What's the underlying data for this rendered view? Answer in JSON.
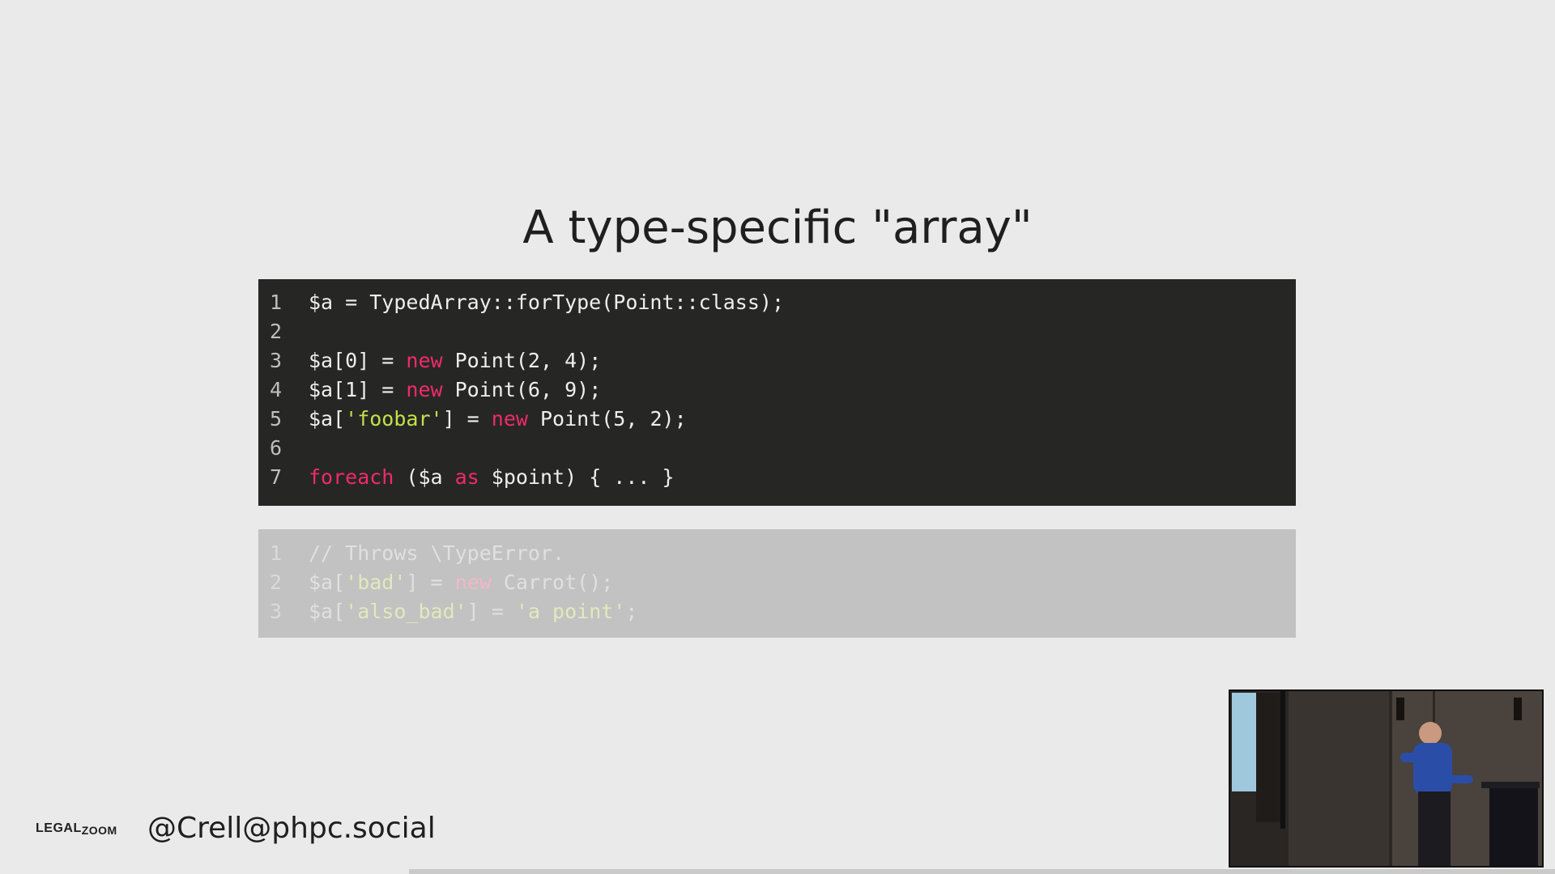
{
  "slide": {
    "title": "A type-specific \"array\""
  },
  "code_block_1": {
    "lines": [
      {
        "num": "1",
        "segments": [
          {
            "text": "$a = TypedArray::forType(Point::class);",
            "kind": "plain"
          }
        ]
      },
      {
        "num": "2",
        "segments": []
      },
      {
        "num": "3",
        "segments": [
          {
            "text": "$a[0] = ",
            "kind": "plain"
          },
          {
            "text": "new",
            "kind": "kw"
          },
          {
            "text": " Point(2, 4);",
            "kind": "plain"
          }
        ]
      },
      {
        "num": "4",
        "segments": [
          {
            "text": "$a[1] = ",
            "kind": "plain"
          },
          {
            "text": "new",
            "kind": "kw"
          },
          {
            "text": " Point(6, 9);",
            "kind": "plain"
          }
        ]
      },
      {
        "num": "5",
        "segments": [
          {
            "text": "$a[",
            "kind": "plain"
          },
          {
            "text": "'foobar'",
            "kind": "str"
          },
          {
            "text": "] = ",
            "kind": "plain"
          },
          {
            "text": "new",
            "kind": "kw"
          },
          {
            "text": " Point(5, 2);",
            "kind": "plain"
          }
        ]
      },
      {
        "num": "6",
        "segments": []
      },
      {
        "num": "7",
        "segments": [
          {
            "text": "foreach",
            "kind": "kw"
          },
          {
            "text": " ($a ",
            "kind": "plain"
          },
          {
            "text": "as",
            "kind": "kw"
          },
          {
            "text": " $point) { ... }",
            "kind": "plain"
          }
        ]
      }
    ]
  },
  "code_block_2": {
    "lines": [
      {
        "num": "1",
        "segments": [
          {
            "text": "// Throws \\TypeError.",
            "kind": "plain"
          }
        ]
      },
      {
        "num": "2",
        "segments": [
          {
            "text": "$a[",
            "kind": "plain"
          },
          {
            "text": "'bad'",
            "kind": "str"
          },
          {
            "text": "] = ",
            "kind": "plain"
          },
          {
            "text": "new",
            "kind": "kw"
          },
          {
            "text": " Carrot();",
            "kind": "plain"
          }
        ]
      },
      {
        "num": "3",
        "segments": [
          {
            "text": "$a[",
            "kind": "plain"
          },
          {
            "text": "'also_bad'",
            "kind": "str"
          },
          {
            "text": "] = ",
            "kind": "plain"
          },
          {
            "text": "'a point'",
            "kind": "str"
          },
          {
            "text": ";",
            "kind": "plain"
          }
        ]
      }
    ]
  },
  "footer": {
    "logo_text_1": "LEGAL",
    "logo_text_2": "ZOOM",
    "handle": "@Crell@phpc.social"
  },
  "colors": {
    "background": "#e9eae9",
    "code_bg": "#262724",
    "keyword": "#f1296e",
    "string": "#c2e04b"
  }
}
